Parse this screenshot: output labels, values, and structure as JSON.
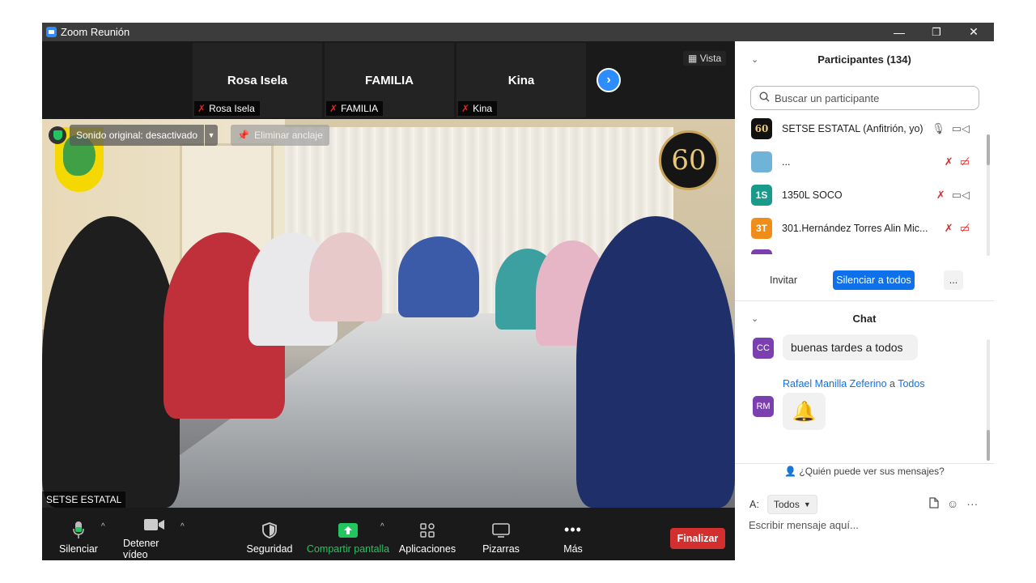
{
  "window": {
    "title": "Zoom Reunión",
    "controls": [
      "—",
      "❐",
      "✕"
    ]
  },
  "thumbnails": [
    {
      "name": "Rosa Isela",
      "label": "Rosa Isela"
    },
    {
      "name": "FAMILIA",
      "label": "FAMILIA"
    },
    {
      "name": "Kina",
      "label": "Kina"
    }
  ],
  "view_button": "Vista",
  "video": {
    "sound_status": "Sonido original: desactivado",
    "unpin": "Eliminar anclaje",
    "speaker": "SETSE ESTATAL",
    "anniversary_logo": "60"
  },
  "toolbar": {
    "mute": "Silenciar",
    "stop_video": "Detener vídeo",
    "security": "Seguridad",
    "share": "Compartir pantalla",
    "apps": "Aplicaciones",
    "whiteboards": "Pizarras",
    "more": "Más",
    "end": "Finalizar"
  },
  "participants": {
    "header": "Participantes (134)",
    "search_placeholder": "Buscar un participante",
    "list": [
      {
        "avatar": "60",
        "name": "SETSE ESTATAL (Anfitrión, yo)",
        "color": "#111111"
      },
      {
        "avatar": "",
        "name": "...",
        "color": "#6fb3d9"
      },
      {
        "avatar": "1S",
        "name": "1350L SOCO",
        "color": "#1a9a8a"
      },
      {
        "avatar": "3T",
        "name": "301.Hernández Torres Alin Mic...",
        "color": "#f08c1a"
      }
    ],
    "invite": "Invitar",
    "mute_all": "Silenciar a todos",
    "more": "..."
  },
  "chat": {
    "header": "Chat",
    "messages": [
      {
        "avatar": "CC",
        "text": "buenas tardes a todos"
      },
      {
        "avatar": "RM",
        "sender": "Rafael Manilla Zeferino",
        "to_word": "a",
        "recipient": "Todos",
        "text": "🔔"
      }
    ],
    "who_can_see": "¿Quién puede ver sus mensajes?",
    "to_label": "A:",
    "to_value": "Todos",
    "input_placeholder": "Escribir mensaje aquí..."
  },
  "colors": {
    "accent": "#0e71eb",
    "share_green": "#22c55e",
    "end_red": "#d32f2f",
    "muted_red": "#e02828"
  }
}
